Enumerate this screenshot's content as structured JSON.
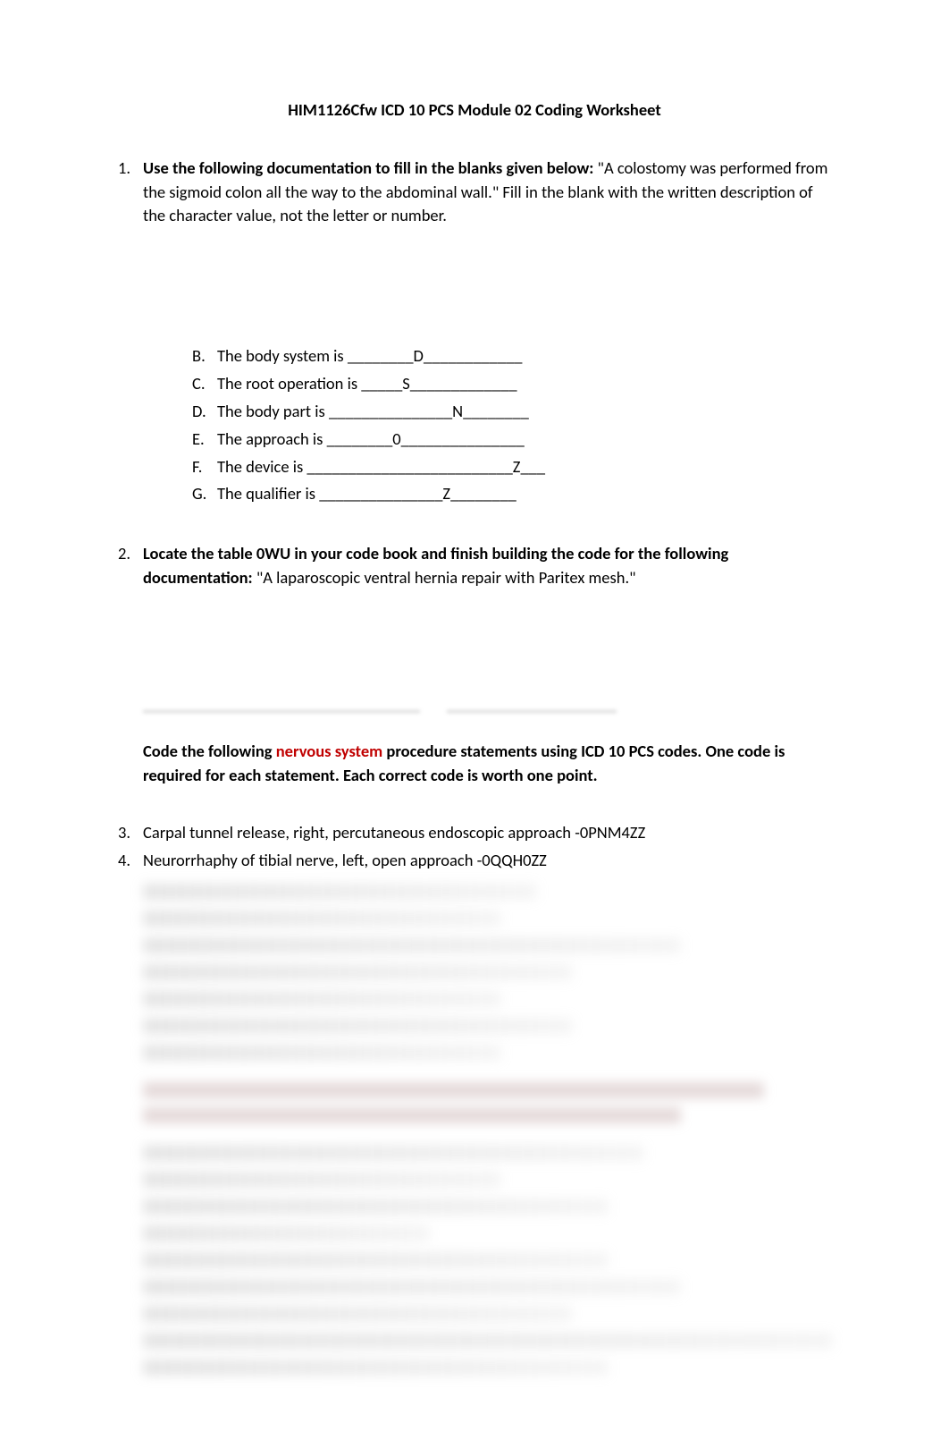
{
  "title": "HIM1126Cfw ICD 10 PCS Module 02 Coding Worksheet",
  "q1": {
    "num": "1.",
    "lead_bold": "Use the following documentation to fill in the blanks given below:",
    "lead_rest": "  \"A colostomy was performed from the sigmoid colon all the way to the abdominal wall.\"    Fill in the blank with the written description of the character value, not the letter or number.",
    "items": {
      "B": {
        "letter": "B.",
        "text": "The body system is ________D____________"
      },
      "C": {
        "letter": "C.",
        "text": "The root operation is _____S_____________"
      },
      "D": {
        "letter": "D.",
        "text": "The body part is _______________N________"
      },
      "E": {
        "letter": "E.",
        "text": "The approach is ________0_______________"
      },
      "F": {
        "letter": "F.",
        "text": "The device is _________________________Z___"
      },
      "G": {
        "letter": "G.",
        "text": "The qualifier is _______________Z________"
      }
    }
  },
  "q2": {
    "num": "2.",
    "lead_bold": "Locate the table 0WU in your code book and finish building the code for the following documentation:",
    "lead_rest": "  \"A laparoscopic ventral hernia repair with Paritex mesh.\""
  },
  "instruction": {
    "pre": "Code the following ",
    "red": "nervous system",
    "post": " procedure statements using ICD 10 PCS codes. One code is required for each statement. Each correct code is worth one point."
  },
  "q3": {
    "num": "3.",
    "text": "Carpal tunnel release, right, percutaneous endoscopic approach -0PNM4ZZ"
  },
  "q4": {
    "num": "4.",
    "text": "Neurorrhaphy of tibial nerve, left, open approach -0QQH0ZZ"
  }
}
